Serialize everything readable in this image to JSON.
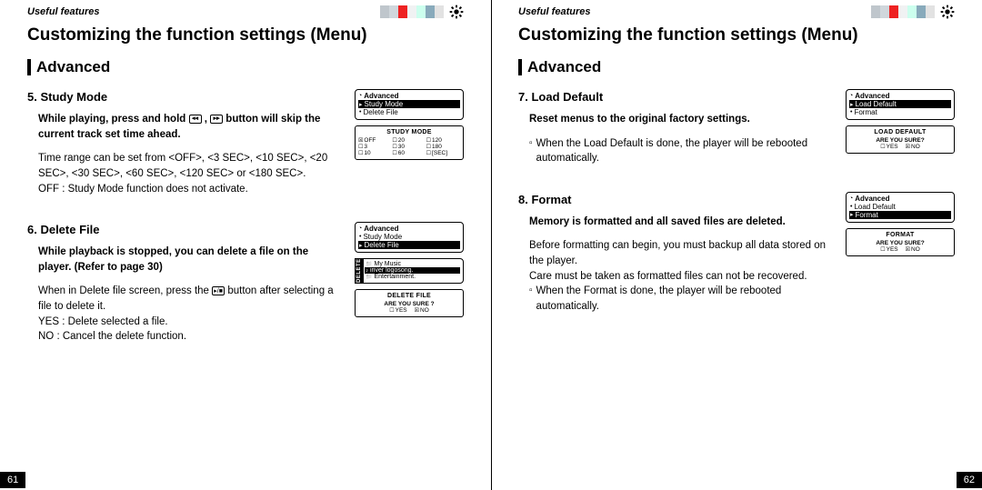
{
  "header": {
    "breadcrumb": "Useful features",
    "title": "Customizing the function settings (Menu)",
    "subtitle": "Advanced"
  },
  "pages": {
    "left": {
      "number": "61"
    },
    "right": {
      "number": "62"
    }
  },
  "sections": {
    "study": {
      "title": "5. Study Mode",
      "intro_pre": "While playing, press and hold ",
      "intro_post": " button will skip the current track set time ahead.",
      "detail1": "Time range can be set from <OFF>, <3 SEC>, <10 SEC>, <20 SEC>, <30 SEC>, <60 SEC>, <120 SEC> or  <180 SEC>.",
      "detail2": "OFF : Study Mode function does not activate.",
      "lcd": {
        "title": "Advanced",
        "items": [
          "Study Mode",
          "Delete File"
        ],
        "sub_title": "STUDY MODE",
        "opts": [
          "OFF",
          "20",
          "120",
          "3",
          "30",
          "180",
          "10",
          "60",
          "[SEC]"
        ]
      }
    },
    "deletefile": {
      "title": "6. Delete File",
      "intro": "While playback is stopped, you can delete a file on the player. (Refer to page 30)",
      "detail_pre": "When in Delete file screen, press the ",
      "detail_post": " button after selecting a file to delete it.",
      "yes": "YES : Delete selected a file.",
      "no": "NO : Cancel the delete function.",
      "lcd": {
        "title": "Advanced",
        "items": [
          "Study Mode",
          "Delete File"
        ],
        "tab": "DELETE",
        "rows": [
          "My Music",
          "iriver logosong.",
          "Entertainment."
        ],
        "sub_title": "DELETE FILE",
        "ask": "ARE YOU SURE ?",
        "yn": [
          "YES",
          "NO"
        ]
      }
    },
    "loaddefault": {
      "title": "7. Load Default",
      "intro": "Reset menus to the original factory settings.",
      "note": "When the Load Default is done, the player will be rebooted automatically.",
      "lcd": {
        "title": "Advanced",
        "items": [
          "Load Default",
          "Format"
        ],
        "sub_title": "LOAD DEFAULT",
        "ask": "ARE YOU SURE?",
        "yn": [
          "YES",
          "NO"
        ]
      }
    },
    "format": {
      "title": "8. Format",
      "intro": "Memory is formatted and all saved files are deleted.",
      "detail1": "Before formatting can begin, you must backup all data stored on the player.",
      "detail2": "Care must be taken as formatted files can not be recovered.",
      "note": "When the Format is done, the player will be rebooted automatically.",
      "lcd": {
        "title": "Advanced",
        "items": [
          "Load Default",
          "Format"
        ],
        "sub_title": "FORMAT",
        "ask": "ARE YOU SURE?",
        "yn": [
          "YES",
          "NO"
        ]
      }
    }
  },
  "icons": {
    "rew": "◂◂",
    "ff": "▸▸",
    "playstop": "▸/■"
  }
}
